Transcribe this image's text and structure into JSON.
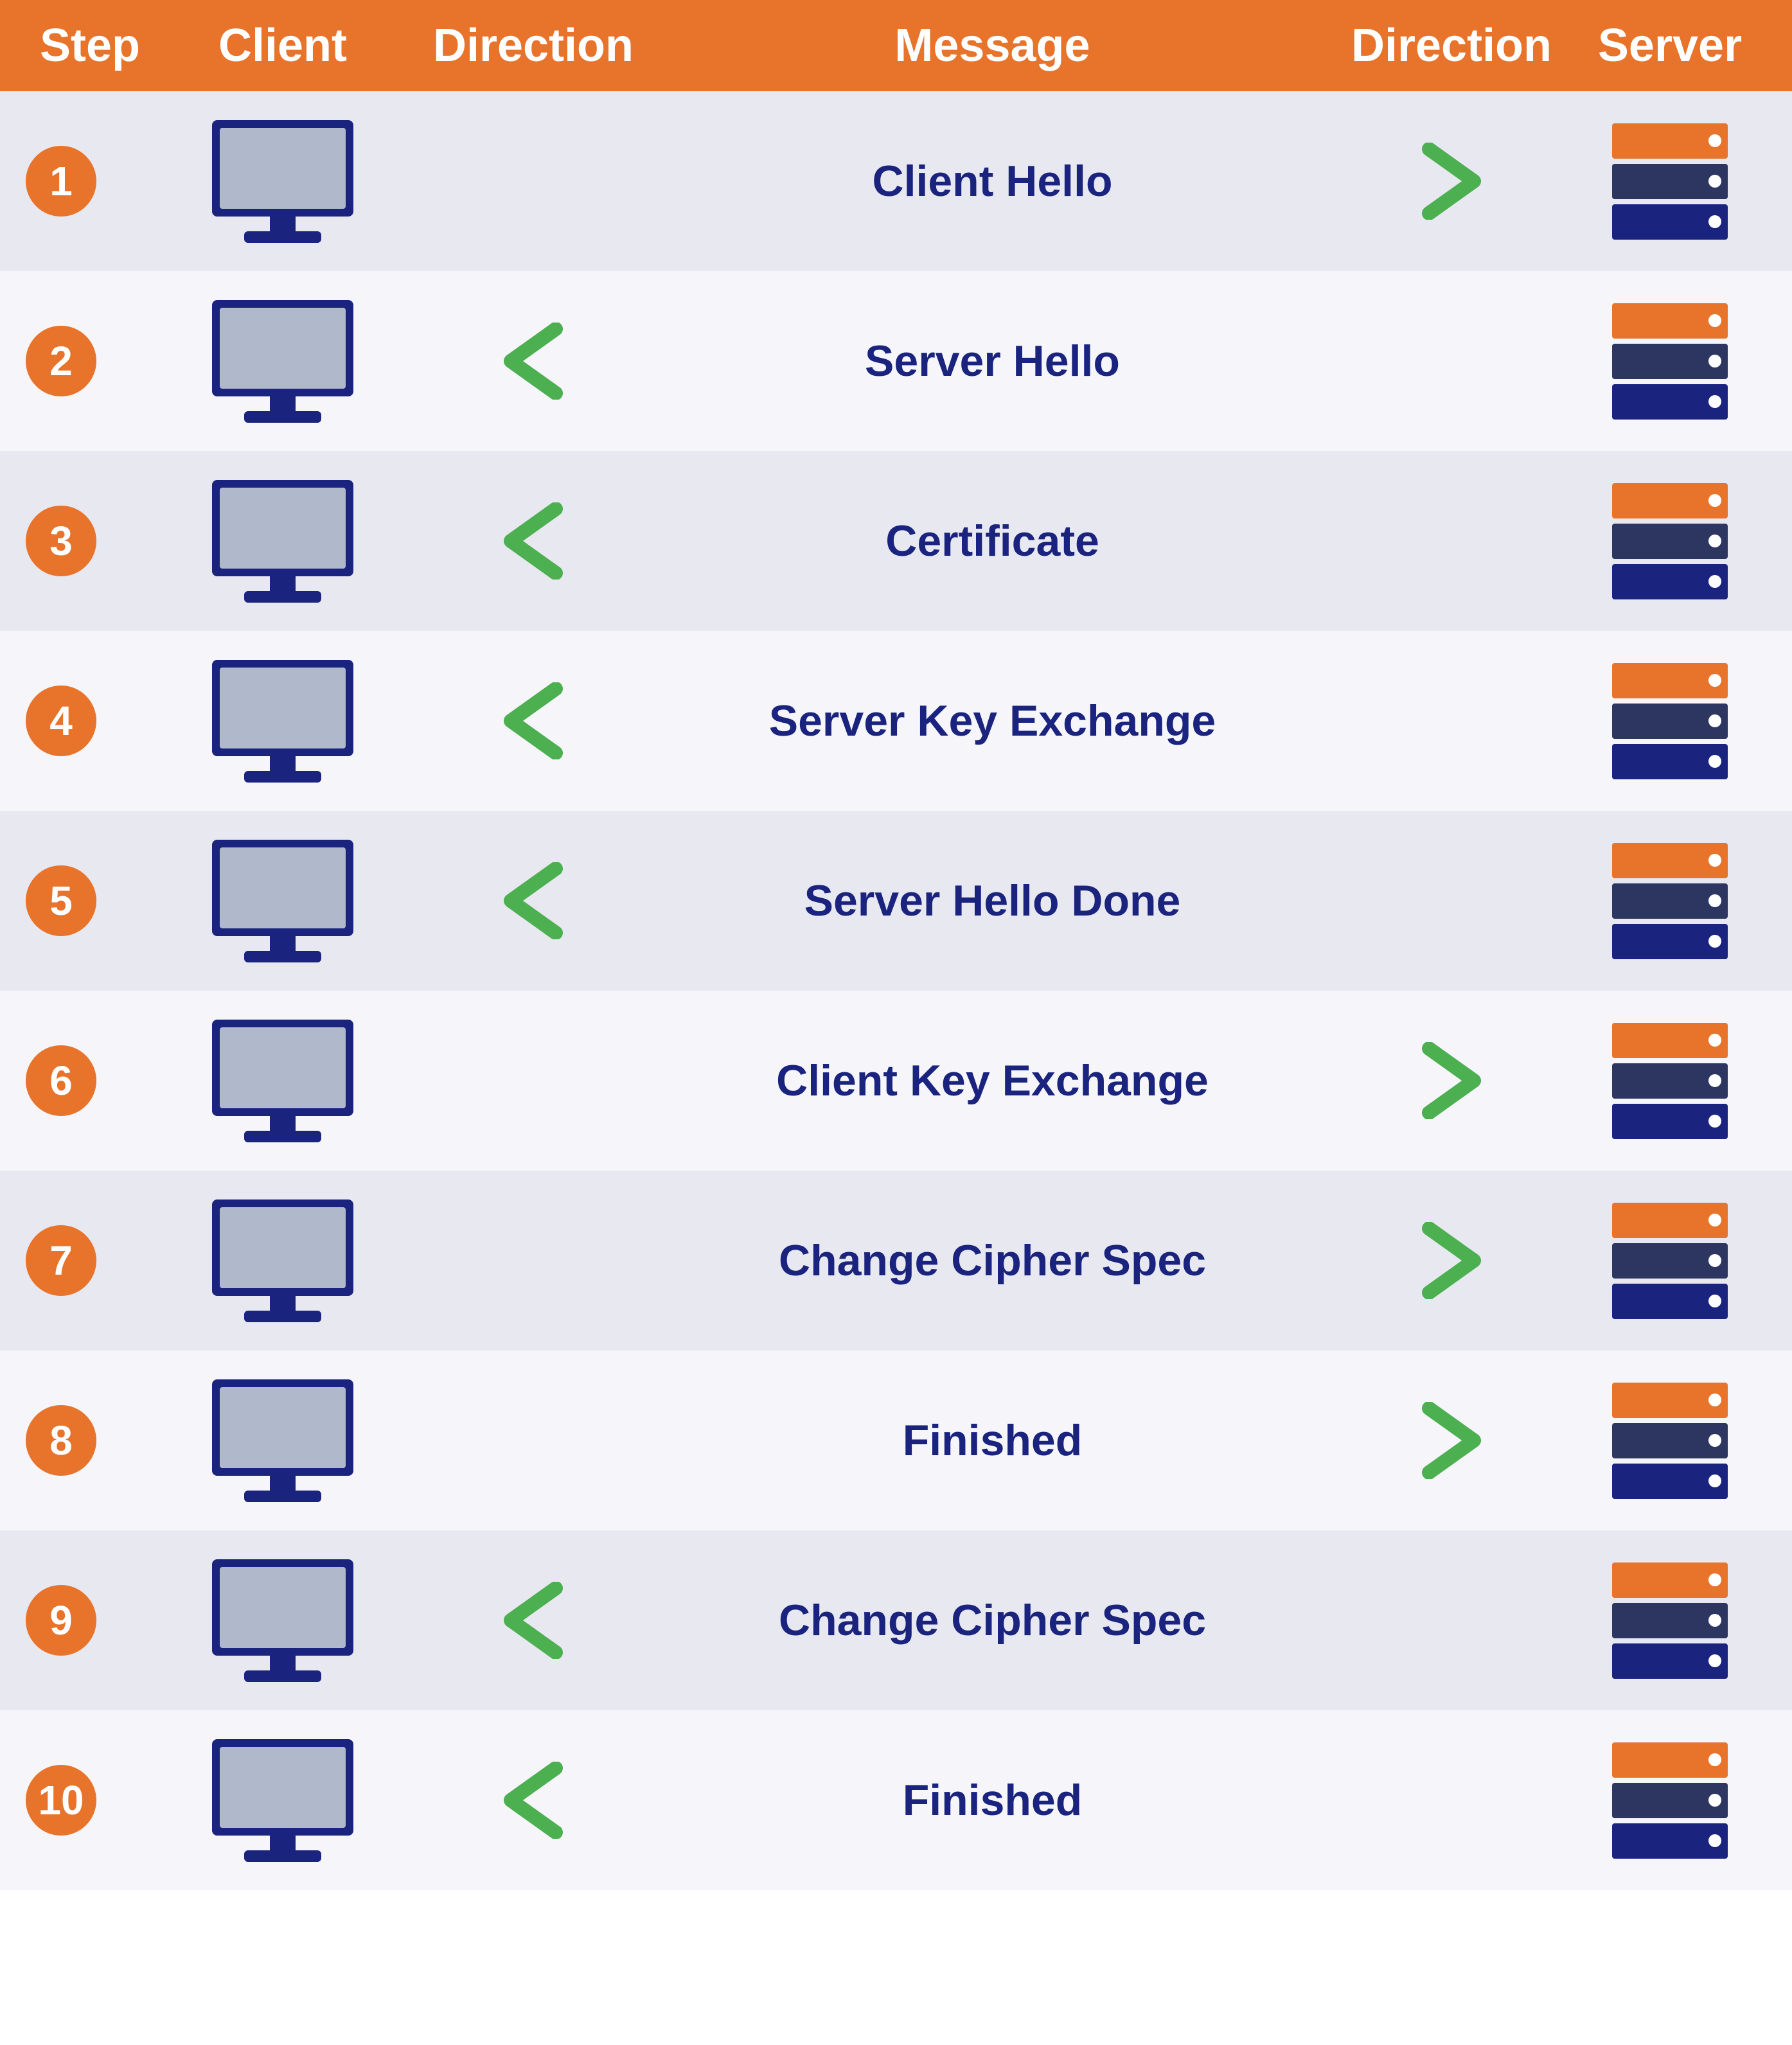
{
  "header": {
    "col1": "Step",
    "col2": "Client",
    "col3": "Direction",
    "col4": "Message",
    "col5": "Direction",
    "col6": "Server"
  },
  "rows": [
    {
      "step": "1",
      "message": "Client Hello",
      "left_arrow": false,
      "right_arrow": true,
      "row_class": "odd"
    },
    {
      "step": "2",
      "message": "Server Hello",
      "left_arrow": true,
      "right_arrow": false,
      "row_class": "even"
    },
    {
      "step": "3",
      "message": "Certificate",
      "left_arrow": true,
      "right_arrow": false,
      "row_class": "odd"
    },
    {
      "step": "4",
      "message": "Server Key Exchange",
      "left_arrow": true,
      "right_arrow": false,
      "row_class": "even"
    },
    {
      "step": "5",
      "message": "Server Hello Done",
      "left_arrow": true,
      "right_arrow": false,
      "row_class": "odd"
    },
    {
      "step": "6",
      "message": "Client Key Exchange",
      "left_arrow": false,
      "right_arrow": true,
      "row_class": "even"
    },
    {
      "step": "7",
      "message": "Change Cipher Spec",
      "left_arrow": false,
      "right_arrow": true,
      "row_class": "odd"
    },
    {
      "step": "8",
      "message": "Finished",
      "left_arrow": false,
      "right_arrow": true,
      "row_class": "even"
    },
    {
      "step": "9",
      "message": "Change Cipher Spec",
      "left_arrow": true,
      "right_arrow": false,
      "row_class": "odd"
    },
    {
      "step": "10",
      "message": "Finished",
      "left_arrow": true,
      "right_arrow": false,
      "row_class": "even"
    }
  ],
  "colors": {
    "header_bg": "#E8732A",
    "orange": "#E8732A",
    "navy": "#1a237e",
    "green": "#4CAF50",
    "odd_row": "#e8e8f0",
    "even_row": "#f5f5fa"
  }
}
